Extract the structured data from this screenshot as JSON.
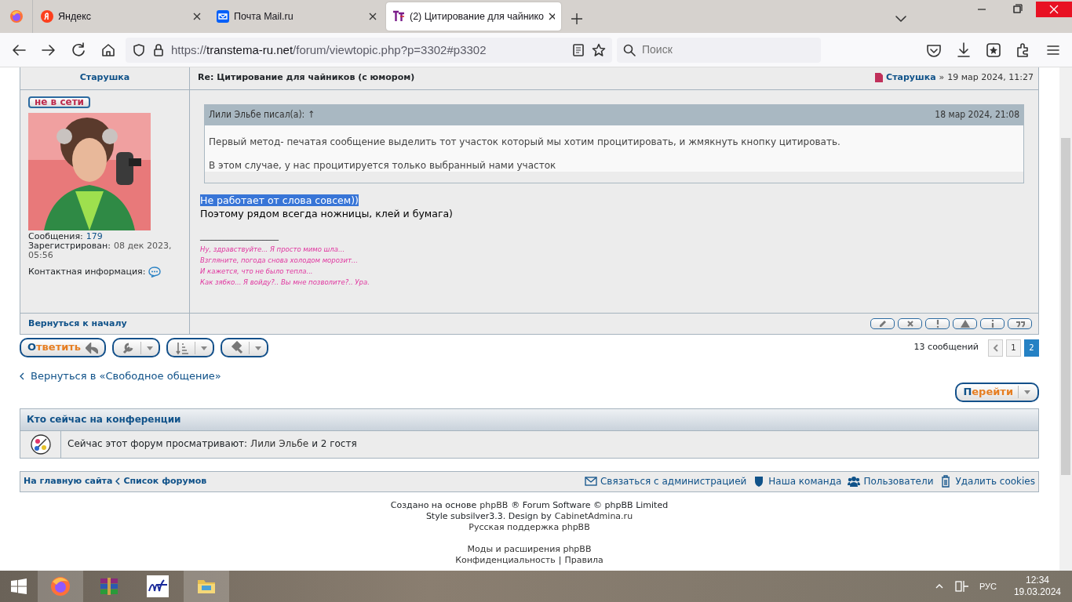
{
  "browser": {
    "tabs": [
      {
        "title": "Яндекс",
        "kind": "yandex",
        "selected": false
      },
      {
        "title": "Почта Mail.ru",
        "kind": "mail",
        "selected": false
      },
      {
        "title": "(2) Цитирование для чайнико",
        "kind": "site",
        "selected": true
      }
    ],
    "url_prefix": "https://",
    "url_host": "transtema-ru.net",
    "url_path": "/forum/viewtopic.php?p=3302#p3302",
    "search_placeholder": "Поиск"
  },
  "post": {
    "author": "Старушка",
    "title": "Re: Цитирование для чайников (с юмором)",
    "byline_author": "Старушка",
    "byline_sep": "»",
    "date": "19 мар 2024, 11:27",
    "status": "не в сети",
    "online": false,
    "profile": [
      {
        "label": "Сообщения:",
        "value": "179",
        "kind": "link"
      },
      {
        "label": "Зарегистрирован:",
        "value": "08 дек 2023, 05:56",
        "kind": "text"
      }
    ],
    "contact_label": "Контактная информация:",
    "quote": {
      "author": "Лили Эльбе",
      "wrote": "писал(а):",
      "arrow": "↑",
      "date": "18 мар 2024, 21:08",
      "paragraphs": [
        "Первый метод- печатая сообщение выделить тот участок который мы хотим процитировать, и жмякнуть кнопку цитировать.",
        "В этом случае, у нас процитируется только выбранный нами участок"
      ]
    },
    "lines": [
      {
        "text": "Не работает от слова совсем))",
        "selected": true
      },
      {
        "text": "Поэтому рядом всегда ножницы, клей и бумага)",
        "selected": false
      }
    ],
    "signature_rule": "____________________",
    "signature": [
      "Ну, здравствуйте... Я просто мимо шла...",
      "Взгляните, погода снова холодом морозит...",
      "И кажется, что не было тепла...",
      "Как зябко... Я войду?.. Вы мне позволите?.. Ура."
    ],
    "back_to_top": "Вернуться к началу"
  },
  "actions": {
    "reply": "Ответить",
    "posts_count": "13 сообщений",
    "pages": [
      {
        "label": "1",
        "selected": false
      },
      {
        "label": "2",
        "selected": true
      }
    ],
    "back_link": "Вернуться в «Свободное общение»",
    "jump": "Перейти"
  },
  "online": {
    "title": "Кто сейчас на конференции",
    "prefix": "Сейчас этот форум просматривают:",
    "user": "Лили Эльбе",
    "suffix": "и 2 гостя"
  },
  "footer_nav": {
    "left": [
      "На главную сайта",
      "Список форумов"
    ],
    "right": [
      {
        "kind": "mail",
        "text": "Связаться с администрацией"
      },
      {
        "kind": "shield",
        "text": "Наша команда"
      },
      {
        "kind": "users",
        "text": "Пользователи"
      },
      {
        "kind": "trash",
        "text": "Удалить cookies"
      }
    ]
  },
  "credits": [
    [
      {
        "text": "Создано на основе",
        "link": false
      },
      {
        "text": "phpBB",
        "link": true
      },
      {
        "text": "® Forum Software © phpBB Limited",
        "link": false
      }
    ],
    [
      {
        "text": "Style subsilver3.3. Design by",
        "link": false
      },
      {
        "text": "CabinetAdmina.ru",
        "link": true
      }
    ],
    [
      {
        "text": "Русская поддержка phpBB",
        "link": true
      }
    ],
    [
      {
        "text": "Моды и расширения phpBB",
        "link": true
      }
    ],
    [
      {
        "text": "Конфиденциальность",
        "link": true
      },
      {
        "text": "|",
        "link": false
      },
      {
        "text": "Правила",
        "link": true
      }
    ]
  ],
  "taskbar": {
    "lang": "РУС",
    "time": "12:34",
    "date": "19.03.2024"
  }
}
